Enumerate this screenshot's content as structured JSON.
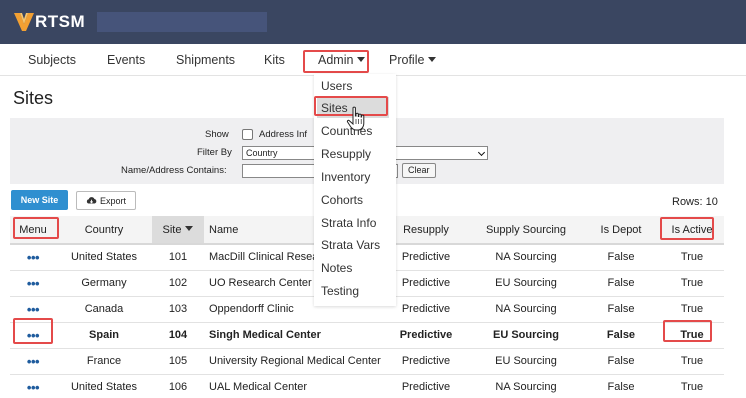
{
  "app": {
    "logo": "RTSM"
  },
  "nav": {
    "items": [
      {
        "label": "Subjects",
        "dropdown": false
      },
      {
        "label": "Events",
        "dropdown": false
      },
      {
        "label": "Shipments",
        "dropdown": false
      },
      {
        "label": "Kits",
        "dropdown": false
      },
      {
        "label": "Admin",
        "dropdown": true,
        "active": true
      },
      {
        "label": "Profile",
        "dropdown": true
      }
    ]
  },
  "admin_menu": {
    "items": [
      "Users",
      "Sites",
      "Countries",
      "Resupply",
      "Inventory",
      "Cohorts",
      "Strata Info",
      "Strata Vars",
      "Notes",
      "Testing"
    ],
    "selected": "Sites"
  },
  "page": {
    "title": "Sites"
  },
  "filters": {
    "show_label": "Show",
    "address_info_label": "Address Inf",
    "filter_by_label": "Filter By",
    "filter_by_value": "Country",
    "contains_label": "Name/Address Contains:",
    "contains_value": "",
    "clear_label": "Clear"
  },
  "toolbar": {
    "new_site_label": "New Site",
    "export_label": "Export",
    "rows_label": "Rows: 10"
  },
  "table": {
    "columns": [
      "Menu",
      "Country",
      "Site",
      "Name",
      "",
      "Resupply",
      "Supply Sourcing",
      "Is Depot",
      "Is Active"
    ],
    "sorted_column": "Site",
    "rows": [
      {
        "menu": "•••",
        "country": "United States",
        "site": "101",
        "name": "MacDill Clinical Research",
        "resupply": "Predictive",
        "sourcing": "NA Sourcing",
        "is_depot": "False",
        "is_active": "True"
      },
      {
        "menu": "•••",
        "country": "Germany",
        "site": "102",
        "name": "UO Research Center",
        "resupply": "Predictive",
        "sourcing": "EU Sourcing",
        "is_depot": "False",
        "is_active": "True"
      },
      {
        "menu": "•••",
        "country": "Canada",
        "site": "103",
        "name": "Oppendorff Clinic",
        "resupply": "Predictive",
        "sourcing": "NA Sourcing",
        "is_depot": "False",
        "is_active": "True"
      },
      {
        "menu": "•••",
        "country": "Spain",
        "site": "104",
        "name": "Singh Medical Center",
        "resupply": "Predictive",
        "sourcing": "EU Sourcing",
        "is_depot": "False",
        "is_active": "True"
      },
      {
        "menu": "•••",
        "country": "France",
        "site": "105",
        "name": "University Regional Medical Center",
        "resupply": "Predictive",
        "sourcing": "EU Sourcing",
        "is_depot": "False",
        "is_active": "True"
      },
      {
        "menu": "•••",
        "country": "United States",
        "site": "106",
        "name": "UAL Medical Center",
        "resupply": "Predictive",
        "sourcing": "NA Sourcing",
        "is_depot": "False",
        "is_active": "True"
      }
    ]
  },
  "colors": {
    "topbar": "#3a4661",
    "highlight": "#e44a4a",
    "primary_button": "#2f8fd0",
    "logo_accent": "#f2a033"
  }
}
